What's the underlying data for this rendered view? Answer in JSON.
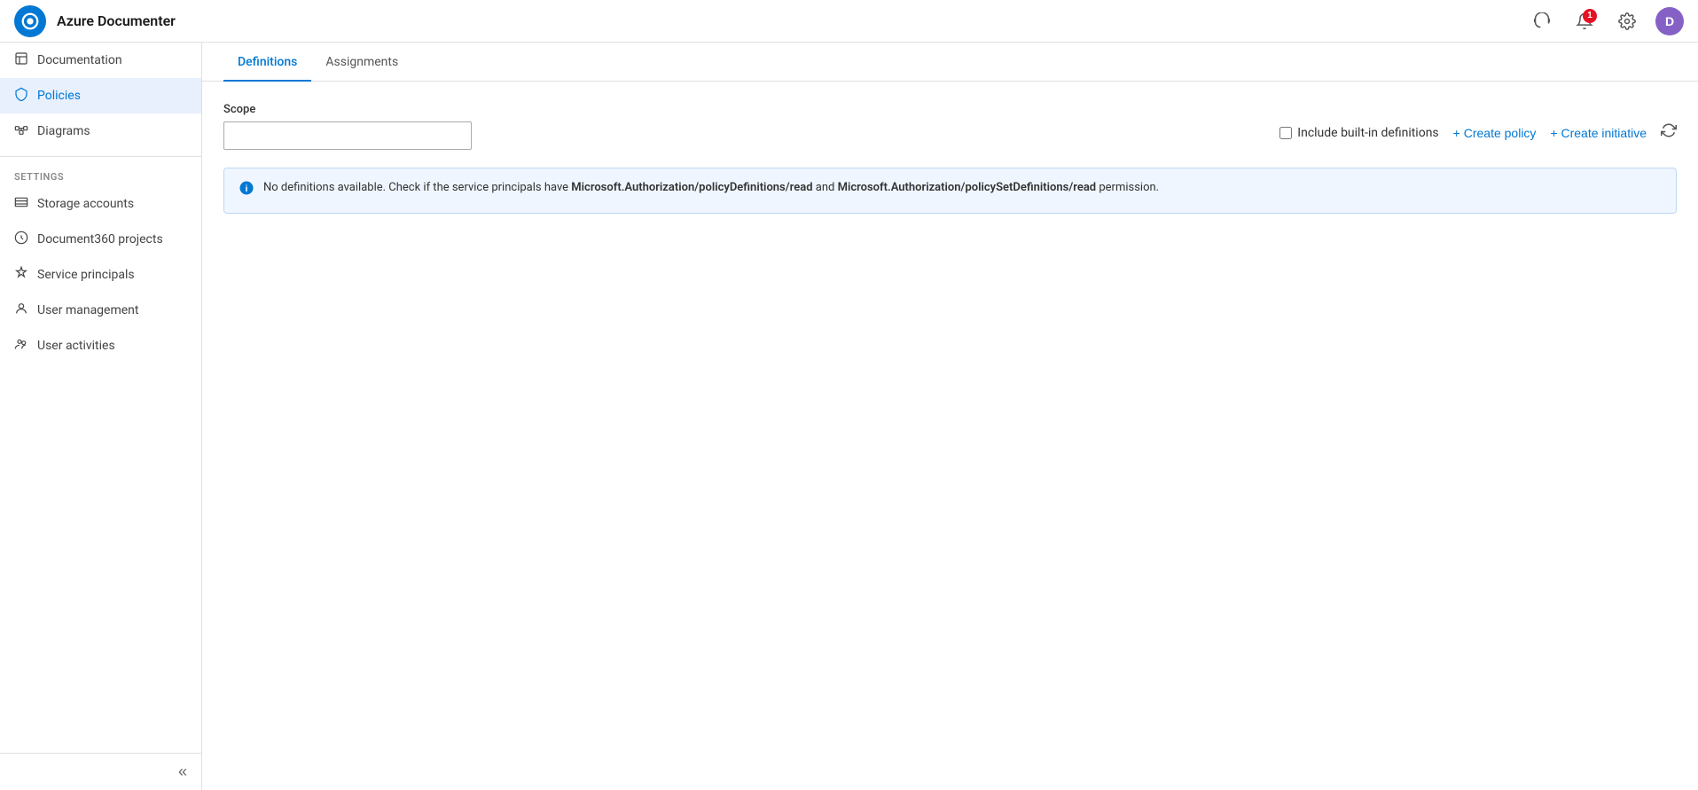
{
  "header": {
    "title": "Azure Documenter",
    "logo_letter": "O",
    "avatar_letter": "D",
    "notification_count": "1"
  },
  "sidebar": {
    "nav_items": [
      {
        "id": "documentation",
        "label": "Documentation",
        "icon": "📋",
        "active": false
      },
      {
        "id": "policies",
        "label": "Policies",
        "icon": "🛡",
        "active": true
      },
      {
        "id": "diagrams",
        "label": "Diagrams",
        "icon": "🗂",
        "active": false
      }
    ],
    "settings_label": "SETTINGS",
    "settings_items": [
      {
        "id": "storage-accounts",
        "label": "Storage accounts",
        "icon": "🗄"
      },
      {
        "id": "document360",
        "label": "Document360 projects",
        "icon": "📝"
      },
      {
        "id": "service-principals",
        "label": "Service principals",
        "icon": "🔑"
      },
      {
        "id": "user-management",
        "label": "User management",
        "icon": "👤"
      },
      {
        "id": "user-activities",
        "label": "User activities",
        "icon": "👥"
      }
    ],
    "collapse_tooltip": "Collapse sidebar"
  },
  "tabs": [
    {
      "id": "definitions",
      "label": "Definitions",
      "active": true
    },
    {
      "id": "assignments",
      "label": "Assignments",
      "active": false
    }
  ],
  "content": {
    "scope_label": "Scope",
    "scope_placeholder": "",
    "include_built_in_label": "Include built-in definitions",
    "create_policy_label": "+ Create policy",
    "create_initiative_label": "+ Create initiative",
    "info_message_prefix": "No definitions available. Check if the service principals have ",
    "info_perm1": "Microsoft.Authorization/policyDefinitions/read",
    "info_message_middle": " and ",
    "info_perm2": "Microsoft.Authorization/policySetDefinitions/read",
    "info_message_suffix": " permission."
  }
}
